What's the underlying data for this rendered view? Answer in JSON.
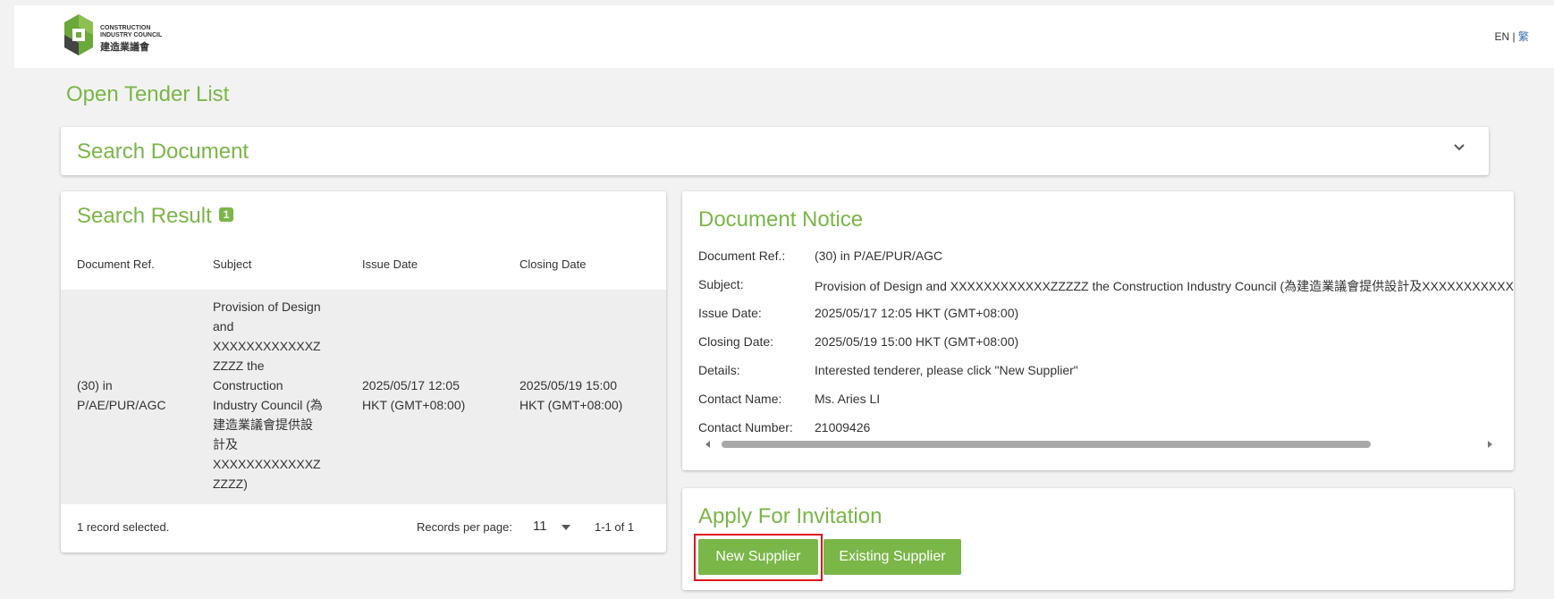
{
  "header": {
    "logo_text": "CONSTRUCTION\nINDUSTRY COUNCIL",
    "logo_cn": "建造業議會",
    "lang_en": "EN",
    "lang_sep": "|",
    "lang_tc": "繁"
  },
  "page_title": "Open Tender List",
  "search_document": {
    "label": "Search Document",
    "icon": "chevron-down-icon"
  },
  "search_result": {
    "title": "Search Result",
    "count": "1",
    "columns": [
      "Document Ref.",
      "Subject",
      "Issue Date",
      "Closing Date"
    ],
    "rows": [
      {
        "ref_lines": [
          "(30) in",
          "P/AE/PUR/AGC"
        ],
        "subject_lines": [
          "Provision of Design",
          "and",
          "XXXXXXXXXXXXZ",
          "ZZZZ the",
          "Construction",
          "Industry Council (為",
          "建造業議會提供設",
          "計及",
          "XXXXXXXXXXXXZ",
          "ZZZZ)"
        ],
        "issue_lines": [
          "2025/05/17 12:05",
          "HKT (GMT+08:00)"
        ],
        "closing_lines": [
          "2025/05/19 15:00",
          "HKT (GMT+08:00)"
        ]
      }
    ],
    "footer": {
      "selected": "1 record selected.",
      "rpp_label": "Records per page:",
      "rpp_value": "11",
      "range": "1-1 of 1"
    }
  },
  "document_notice": {
    "title": "Document Notice",
    "fields": [
      {
        "label": "Document Ref.:",
        "value": "(30) in P/AE/PUR/AGC"
      },
      {
        "label": "Subject:",
        "value": "Provision of Design and XXXXXXXXXXXXZZZZZ the Construction Industry Council (為建造業議會提供設計及XXXXXXXXXXXXZZZZZ)"
      },
      {
        "label": "Issue Date:",
        "value": "2025/05/17 12:05 HKT (GMT+08:00)"
      },
      {
        "label": "Closing Date:",
        "value": "2025/05/19 15:00 HKT (GMT+08:00)"
      },
      {
        "label": "Details:",
        "value": "Interested tenderer, please click \"New Supplier\""
      },
      {
        "label": "Contact Name:",
        "value": "Ms. Aries LI"
      },
      {
        "label": "Contact Number:",
        "value": "21009426"
      }
    ]
  },
  "apply": {
    "title": "Apply For Invitation",
    "new_supplier": "New Supplier",
    "existing_supplier": "Existing Supplier"
  },
  "colors": {
    "accent": "#7ab648",
    "highlight": "#e0141e"
  }
}
